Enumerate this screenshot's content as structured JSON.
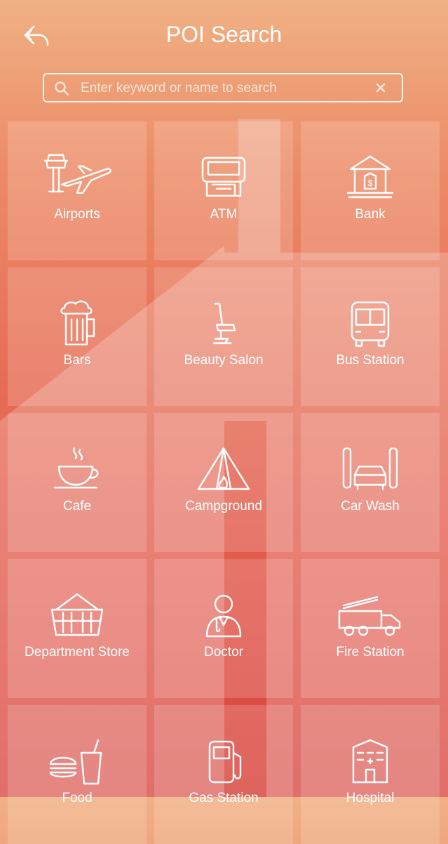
{
  "header": {
    "title": "POI Search"
  },
  "search": {
    "placeholder": "Enter keyword or name to search"
  },
  "categories": [
    {
      "label": "Airports",
      "icon": "airport-icon"
    },
    {
      "label": "ATM",
      "icon": "atm-icon"
    },
    {
      "label": "Bank",
      "icon": "bank-icon"
    },
    {
      "label": "Bars",
      "icon": "beer-mug-icon"
    },
    {
      "label": "Beauty Salon",
      "icon": "salon-chair-icon"
    },
    {
      "label": "Bus Station",
      "icon": "bus-icon"
    },
    {
      "label": "Cafe",
      "icon": "coffee-cup-icon"
    },
    {
      "label": "Campground",
      "icon": "tent-icon"
    },
    {
      "label": "Car Wash",
      "icon": "car-wash-icon"
    },
    {
      "label": "Department Store",
      "icon": "basket-icon"
    },
    {
      "label": "Doctor",
      "icon": "doctor-icon"
    },
    {
      "label": "Fire Station",
      "icon": "fire-truck-icon"
    },
    {
      "label": "Food",
      "icon": "burger-drink-icon"
    },
    {
      "label": "Gas Station",
      "icon": "gas-pump-icon"
    },
    {
      "label": "Hospital",
      "icon": "hospital-icon"
    }
  ],
  "colors": {
    "gradient_top": "#f0b184",
    "gradient_bottom": "#d8463f",
    "text": "#ffffff"
  }
}
